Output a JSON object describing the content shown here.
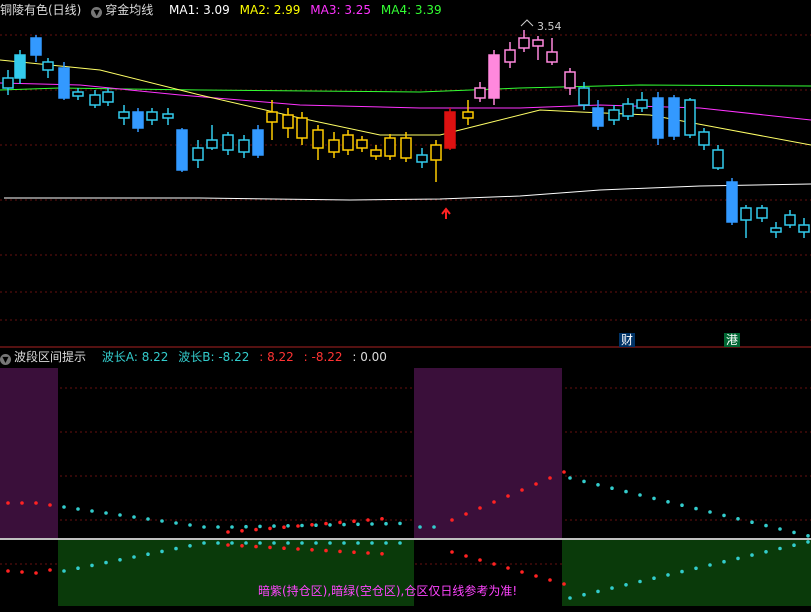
{
  "upper_panel": {
    "stock_title": "铜陵有色(日线)",
    "indicator_name": "穿金均线",
    "ma1": {
      "label": "MA1: 3.09",
      "color": "#ffffff"
    },
    "ma2": {
      "label": "MA2: 2.99",
      "color": "#ffff00"
    },
    "ma3": {
      "label": "MA3: 3.25",
      "color": "#ff33ff"
    },
    "ma4": {
      "label": "MA4: 3.39",
      "color": "#33ff33"
    },
    "high_marker": "3.54",
    "badge_cai": "财",
    "badge_gang": "港"
  },
  "lower_panel": {
    "indicator_name": "波段区间提示",
    "wave_a": {
      "label": "波长A: 8.22",
      "color": "#33cccc"
    },
    "wave_b": {
      "label": "波长B: -8.22",
      "color": "#33cccc"
    },
    "red_pos": {
      "label": ": 8.22",
      "color": "#ff3333"
    },
    "red_neg": {
      "label": ": -8.22",
      "color": "#ff3333"
    },
    "zero": {
      "label": ": 0.00",
      "color": "#dddddd"
    },
    "caption": "暗紫(持仓区),暗绿(空仓区),仓区仅日线参考为准!"
  },
  "colors": {
    "up_cyan": "#33ccee",
    "down_blue": "#3399ff",
    "yellow_candle": "#ffcc00",
    "pink_candle": "#ff88dd",
    "dark_purple": "#3a0f3a",
    "dark_green": "#0a3a0a"
  }
}
